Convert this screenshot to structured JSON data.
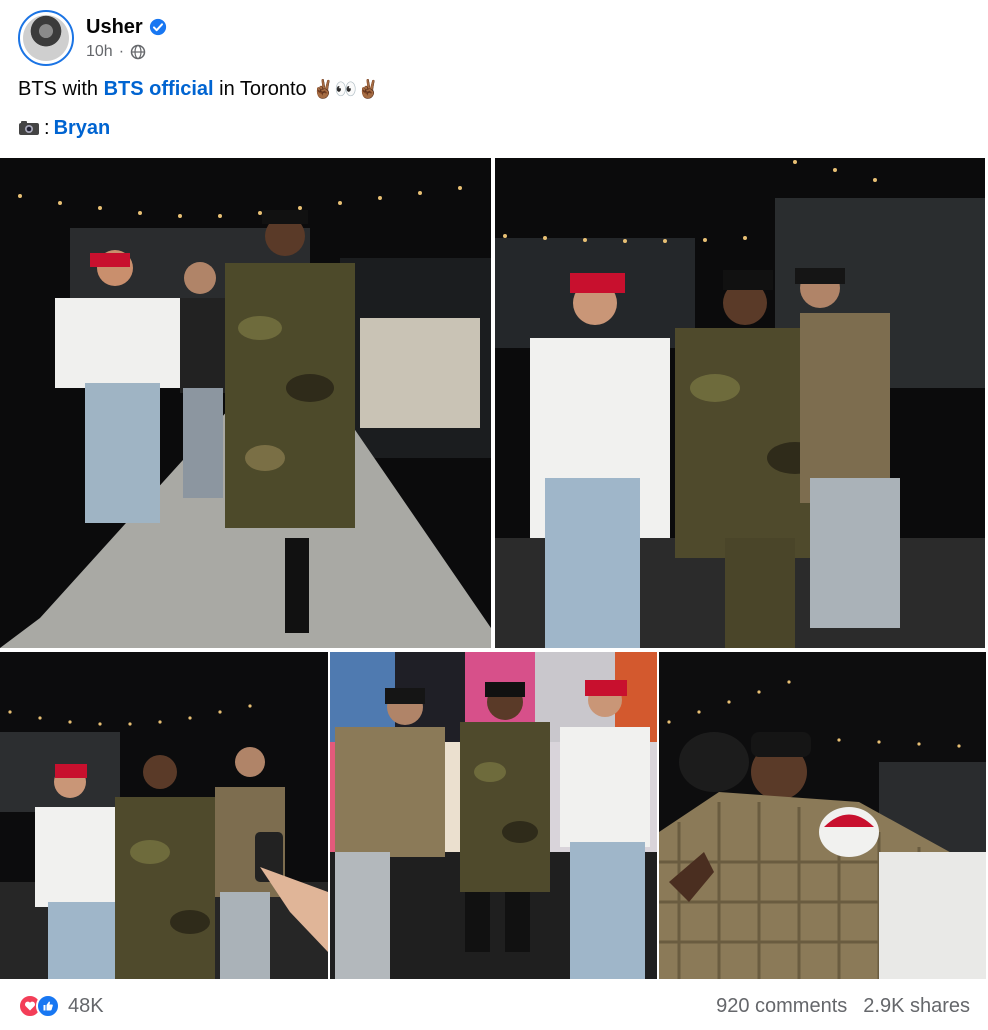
{
  "post": {
    "author": "Usher",
    "timestamp": "10h",
    "separator": "·",
    "caption_prefix": "BTS with",
    "caption_link": "BTS official",
    "caption_suffix": "in Toronto",
    "caption_emoji": "✌🏾👀✌🏾",
    "credit_link": "Bryan",
    "credit_colon": ":"
  },
  "footer": {
    "reaction_count": "48K",
    "comments": "920 comments",
    "shares": "2.9K shares"
  },
  "icons": {
    "verified": "verified-badge-icon",
    "audience": "globe-icon",
    "camera": "camera-icon",
    "love": "love-reaction-icon",
    "like": "like-reaction-icon"
  },
  "colors": {
    "link": "#0064d1",
    "verified": "#1877f2",
    "love": "#f33e58",
    "like": "#1877f2",
    "muted": "#65676b"
  }
}
